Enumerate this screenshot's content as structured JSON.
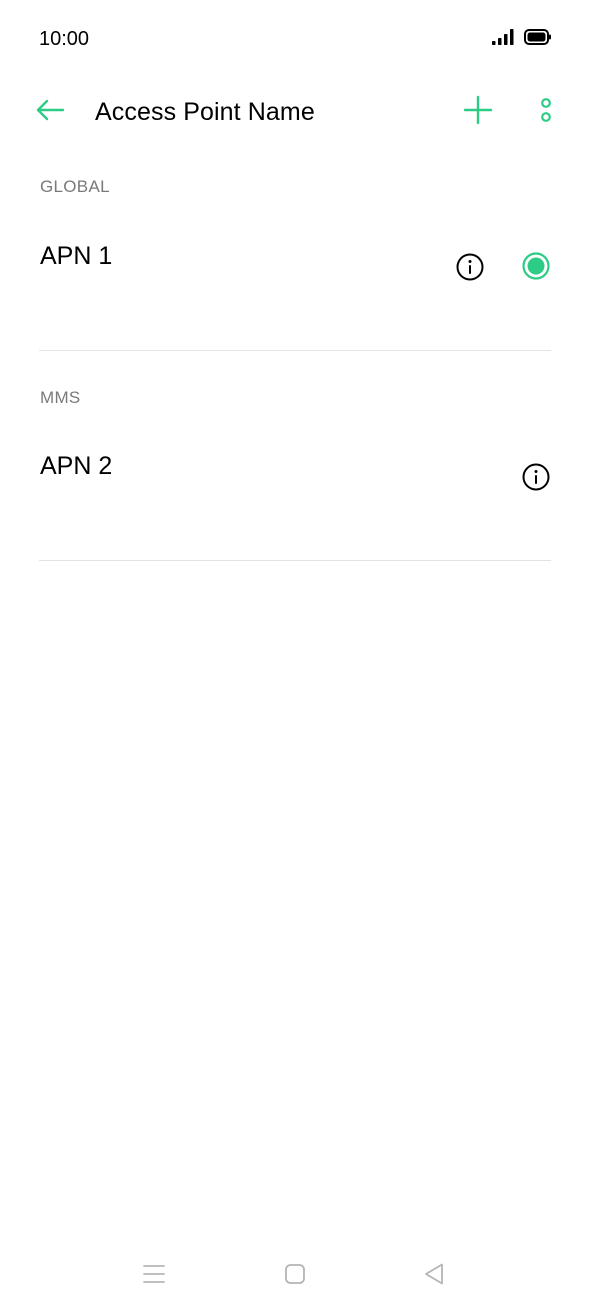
{
  "status_bar": {
    "time": "10:00",
    "icons": [
      "signal-icon",
      "battery-icon"
    ]
  },
  "app_bar": {
    "title": "Access Point Name",
    "back_icon": "arrow-left-icon",
    "add_icon": "plus-icon",
    "more_icon": "more-vertical-icon"
  },
  "sections": [
    {
      "header": "GLOBAL",
      "items": [
        {
          "name": "APN 1",
          "selected": true
        }
      ]
    },
    {
      "header": "MMS",
      "items": [
        {
          "name": "APN 2",
          "selected": false
        }
      ]
    }
  ],
  "nav_bar": {
    "icons": [
      "menu-icon",
      "home-icon",
      "back-triangle-icon"
    ]
  },
  "colors": {
    "accent": "#2ccc86",
    "text_primary": "#000000",
    "text_secondary": "#7a7a7a",
    "divider": "#e3e3e3",
    "nav_icon": "#b5b5b5"
  }
}
